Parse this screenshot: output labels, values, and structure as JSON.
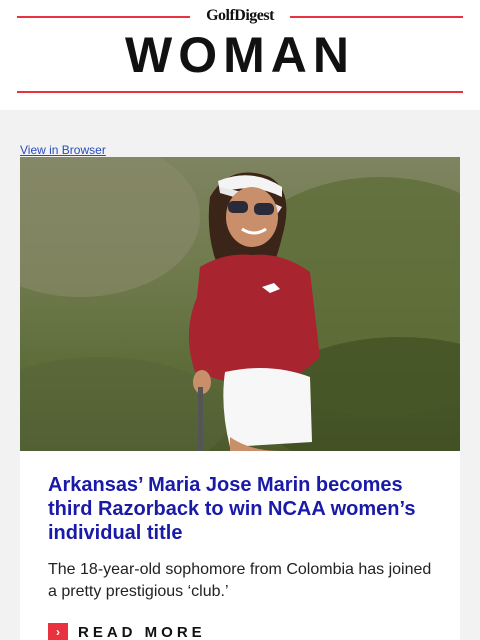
{
  "masthead": {
    "brand_small": "GolfDigest",
    "brand_big": "WOMAN",
    "accent_color": "#e8323f"
  },
  "view_in_browser": "View in Browser",
  "hero_image": {
    "icon": "golfer-photo"
  },
  "article": {
    "headline": "Arkansas’ Maria Jose Marin becomes third Razorback to win NCAA women’s individual title",
    "dek": "The 18-year-old sophomore from Colombia has joined a pretty prestigious ‘club.’",
    "read_more_label": "READ MORE",
    "read_more_icon": "chevron-right-icon",
    "headline_color": "#1a1aa8"
  }
}
